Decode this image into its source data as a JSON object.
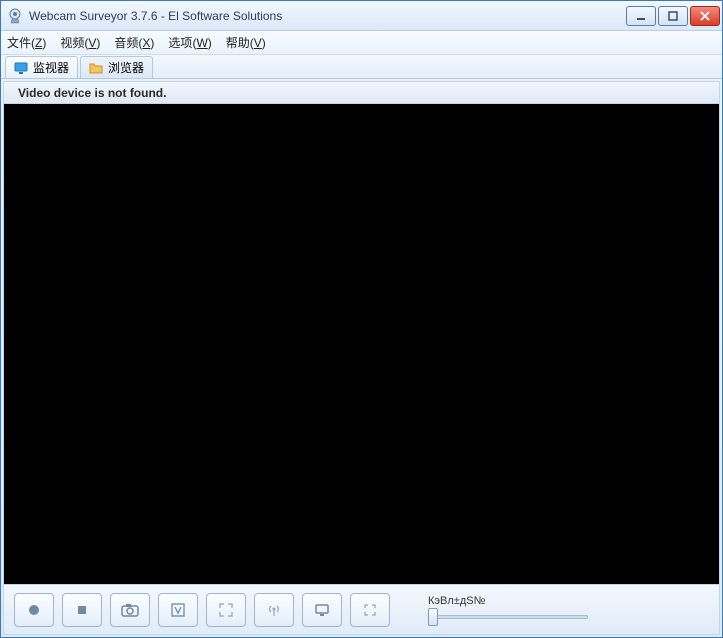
{
  "window": {
    "title": "Webcam Surveyor 3.7.6 - El Software Solutions"
  },
  "menus": {
    "file": {
      "label": "文件",
      "accel": "Z"
    },
    "video": {
      "label": "视频",
      "accel": "V"
    },
    "audio": {
      "label": "音频",
      "accel": "X"
    },
    "options": {
      "label": "选项",
      "accel": "W"
    },
    "help": {
      "label": "帮助",
      "accel": "V"
    }
  },
  "tabs": {
    "monitor": {
      "label": "监视器"
    },
    "browser": {
      "label": "浏览器"
    }
  },
  "status": {
    "message": "Video device is not found."
  },
  "slider": {
    "label": "КэВл±дS№"
  }
}
